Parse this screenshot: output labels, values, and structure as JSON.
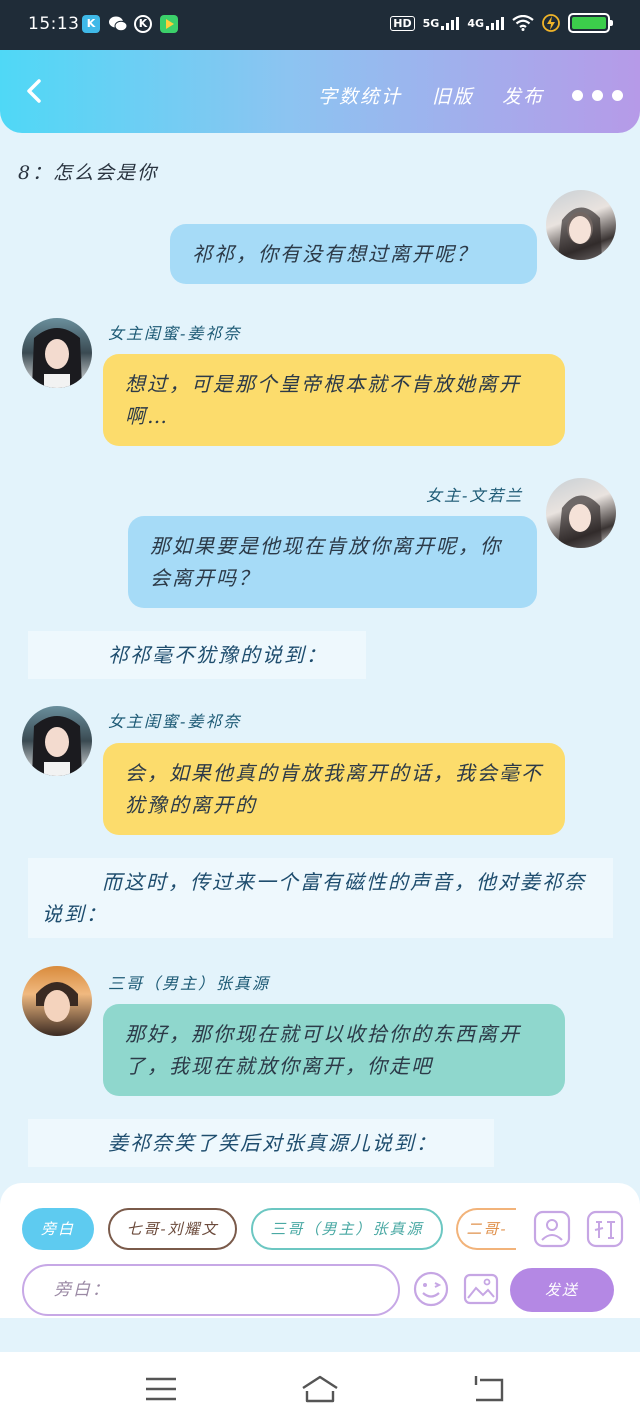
{
  "status_bar": {
    "time": "15:13",
    "network_labels": [
      "HD",
      "5G",
      "4G"
    ],
    "app_icons": [
      "k-app-icon",
      "wechat-icon",
      "k-circle-icon",
      "video-app-icon"
    ]
  },
  "header": {
    "links": [
      "字数统计",
      "旧版",
      "发布"
    ]
  },
  "content": {
    "intro": "8：怎么会是你",
    "messages": [
      {
        "speaker": "",
        "text": "祁祁，你有没有想过离开呢？"
      },
      {
        "speaker": "女主闺蜜-姜祁奈",
        "text": "想过，可是那个皇帝根本就不肯放她离开啊…"
      },
      {
        "speaker": "女主-文若兰",
        "text": "那如果要是他现在肯放你离开呢，你会离开吗？"
      },
      {
        "speaker": "女主闺蜜-姜祁奈",
        "text": "会，如果他真的肯放我离开的话，我会毫不犹豫的离开的"
      },
      {
        "speaker": "三哥（男主）张真源",
        "text": "那好，那你现在就可以收拾你的东西离开了，我现在就放你离开，你走吧"
      }
    ],
    "narrations": [
      "祁祁毫不犹豫的说到：",
      "而这时，传过来一个富有磁性的声音，他对姜祁奈说到：",
      "姜祁奈笑了笑后对张真源儿说到："
    ]
  },
  "composer": {
    "roles": [
      "旁白",
      "七哥-刘耀文",
      "三哥（男主）张真源",
      "二哥-"
    ],
    "input_placeholder": "旁白：",
    "send_label": "发送",
    "colors": {
      "active_role": "#5ecbf0",
      "send": "#b488e4"
    }
  }
}
